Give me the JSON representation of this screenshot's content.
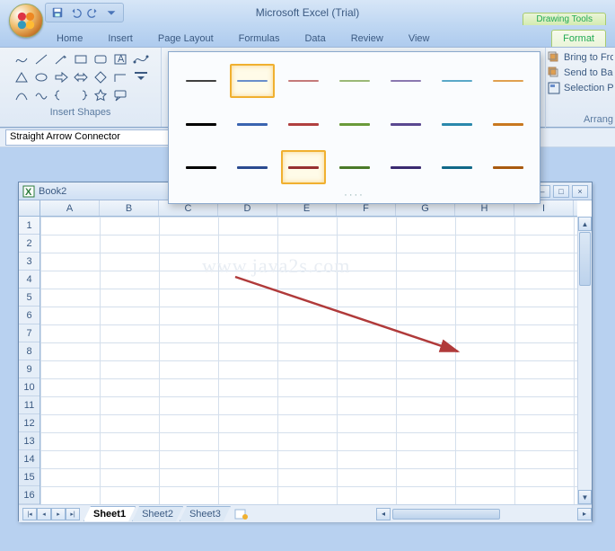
{
  "app_title": "Microsoft Excel (Trial)",
  "context_tools_label": "Drawing Tools",
  "tabs": {
    "home": "Home",
    "insert": "Insert",
    "page_layout": "Page Layout",
    "formulas": "Formulas",
    "data": "Data",
    "review": "Review",
    "view": "View",
    "format": "Format"
  },
  "shapes_group_label": "Insert Shapes",
  "right_commands": {
    "bring_front": "Bring to Fro",
    "send_back": "Send to Bac",
    "selection_pane": "Selection Pa",
    "arrange": "Arrang"
  },
  "name_box_value": "Straight Arrow Connector",
  "workbook": {
    "title": "Book2",
    "columns": [
      "A",
      "B",
      "C",
      "D",
      "E",
      "F",
      "G",
      "H",
      "I"
    ],
    "rows": [
      "1",
      "2",
      "3",
      "4",
      "5",
      "6",
      "7",
      "8",
      "9",
      "10",
      "11",
      "12",
      "13",
      "14",
      "15",
      "16"
    ],
    "sheets": [
      "Sheet1",
      "Sheet2",
      "Sheet3"
    ],
    "active_sheet": 0
  },
  "watermark": "www.java2s.com",
  "style_gallery": {
    "selected_row1": 1,
    "selected_row3": 2,
    "rows": [
      [
        "#404040",
        "#6a8ecb",
        "#c47a7a",
        "#9ab877",
        "#8a78b0",
        "#5aa8c8",
        "#e0a050"
      ],
      [
        "#000000",
        "#3a64b0",
        "#b04040",
        "#6a9a3a",
        "#5a4890",
        "#2a88ac",
        "#c87820"
      ],
      [
        "#000000",
        "#2a4a90",
        "#983030",
        "#4a7a28",
        "#3a2a70",
        "#106888",
        "#a85a10"
      ]
    ],
    "thickness": [
      2,
      3,
      3
    ]
  }
}
